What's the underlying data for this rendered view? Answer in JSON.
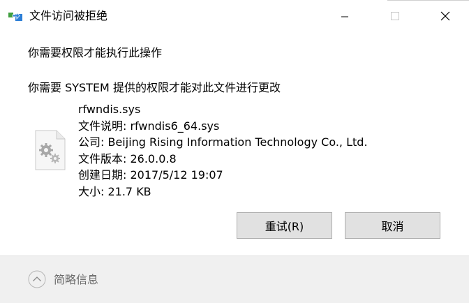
{
  "window": {
    "title": "文件访问被拒绝",
    "icon": "file-transfer-icon",
    "controls": [
      "minimize-icon",
      "maximize-icon",
      "close-icon"
    ]
  },
  "dialog": {
    "heading": "你需要权限才能执行此操作",
    "message": "你需要 SYSTEM 提供的权限才能对此文件进行更改",
    "file": {
      "icon": "system-file-gears-icon",
      "name": "rfwndis.sys",
      "description": "文件说明: rfwndis6_64.sys",
      "company": "公司: Beijing Rising Information Technology Co., Ltd.",
      "version": "文件版本: 26.0.0.8",
      "created": "创建日期: 2017/5/12 19:07",
      "size": "大小: 21.7 KB"
    },
    "buttons": {
      "retry": "重试(R)",
      "cancel": "取消"
    }
  },
  "footer": {
    "toggle_icon": "chevron-up-icon",
    "label": "简略信息"
  }
}
